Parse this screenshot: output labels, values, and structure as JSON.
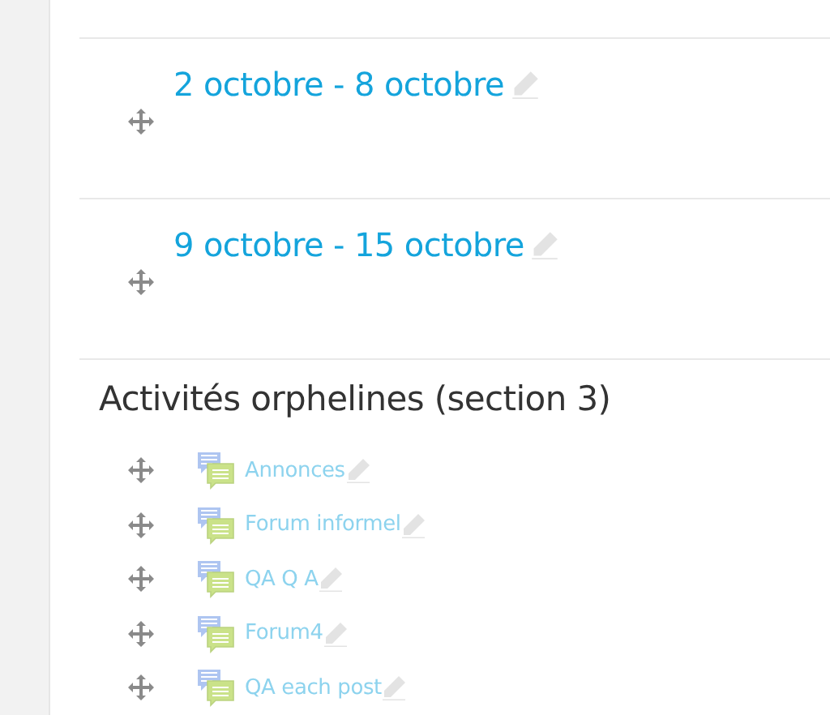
{
  "sections": [
    {
      "title": "2 octobre - 8 octobre"
    },
    {
      "title": "9 octobre - 15 octobre"
    }
  ],
  "orphan_section": {
    "heading": "Activités orphelines (section 3)",
    "activities": [
      {
        "name": "Annonces",
        "hidden": true
      },
      {
        "name": "Forum informel",
        "hidden": true
      },
      {
        "name": "QA Q A",
        "hidden": true
      },
      {
        "name": "Forum4",
        "hidden": true
      },
      {
        "name": "QA each post",
        "hidden": true
      }
    ]
  }
}
